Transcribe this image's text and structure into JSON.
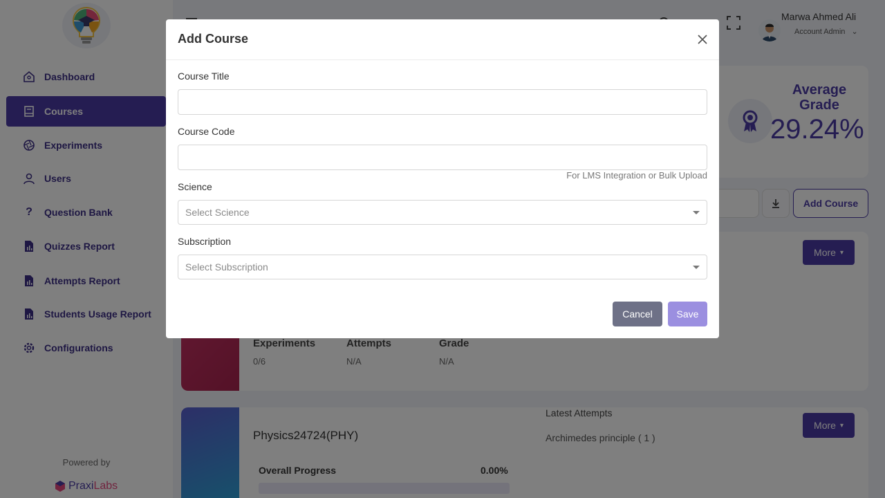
{
  "sidebar": {
    "items": [
      {
        "label": "Dashboard",
        "icon": "home-icon"
      },
      {
        "label": "Courses",
        "icon": "book-icon"
      },
      {
        "label": "Experiments",
        "icon": "aperture-icon"
      },
      {
        "label": "Users",
        "icon": "user-icon"
      },
      {
        "label": "Question Bank",
        "icon": "question-icon"
      },
      {
        "label": "Quizzes Report",
        "icon": "report-icon"
      },
      {
        "label": "Attempts Report",
        "icon": "report-icon"
      },
      {
        "label": "Students Usage Report",
        "icon": "report-icon"
      },
      {
        "label": "Configurations",
        "icon": "gear-icon"
      }
    ],
    "powered_by": "Powered by",
    "brand_part1": "Praxi",
    "brand_part2": "Labs"
  },
  "header": {
    "user_name": "Marwa Ahmed Ali",
    "user_role": "Account Admin"
  },
  "stats": {
    "avg_grade_label": "Average Grade",
    "avg_grade_value": "29.24%"
  },
  "toolbar": {
    "add_course_label": "Add Course"
  },
  "course_cards": [
    {
      "more_label": "More",
      "stats": [
        {
          "label": "Experiments",
          "value": "0/6"
        },
        {
          "label": "Attempts",
          "value": "N/A"
        },
        {
          "label": "Grade",
          "value": "N/A"
        }
      ]
    },
    {
      "more_label": "More",
      "title": "Physics24724(PHY)",
      "latest_attempts_label": "Latest Attempts",
      "latest_attempts_value": "Archimedes principle ( 1 )",
      "progress_label": "Overall Progress",
      "progress_value": "0.00%",
      "progress_fraction": 0.0
    }
  ],
  "modal": {
    "title": "Add Course",
    "course_title_label": "Course Title",
    "course_title_value": "",
    "course_code_label": "Course Code",
    "course_code_value": "",
    "course_code_hint": "For LMS Integration or Bulk Upload",
    "science_label": "Science",
    "science_placeholder": "Select Science",
    "subscription_label": "Subscription",
    "subscription_placeholder": "Select Subscription",
    "cancel_label": "Cancel",
    "save_label": "Save"
  },
  "colors": {
    "primary": "#4a3aa4",
    "save_disabled": "#9b8fe0",
    "cancel": "#6e7187"
  }
}
